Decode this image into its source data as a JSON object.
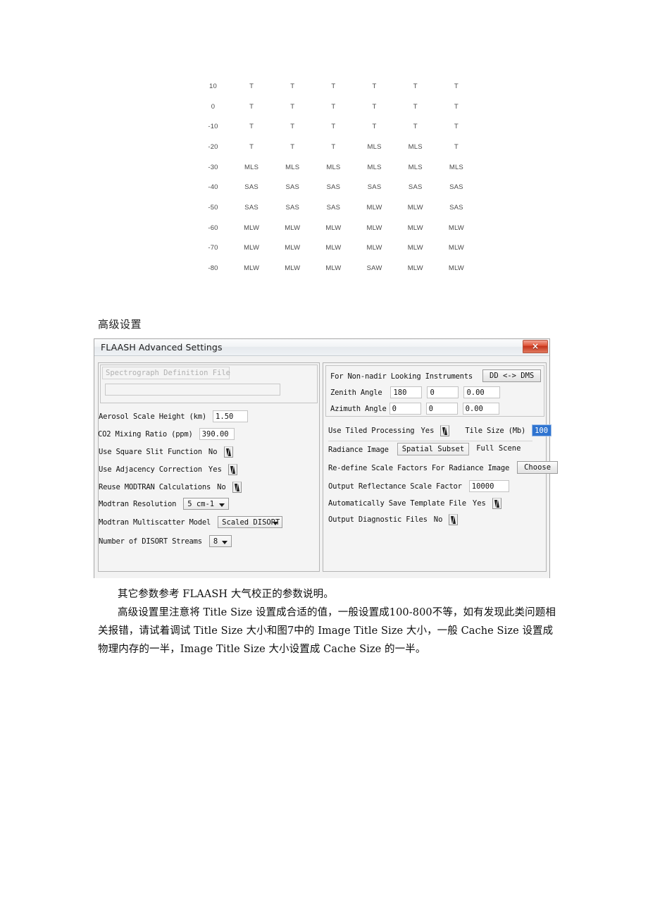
{
  "atmosphere_table": {
    "type": "table",
    "row_labels": [
      "10",
      "0",
      "-10",
      "-20",
      "-30",
      "-40",
      "-50",
      "-60",
      "-70",
      "-80"
    ],
    "rows": [
      [
        "10",
        "T",
        "T",
        "T",
        "T",
        "T",
        "T"
      ],
      [
        "0",
        "T",
        "T",
        "T",
        "T",
        "T",
        "T"
      ],
      [
        "-10",
        "T",
        "T",
        "T",
        "T",
        "T",
        "T"
      ],
      [
        "-20",
        "T",
        "T",
        "T",
        "MLS",
        "MLS",
        "T"
      ],
      [
        "-30",
        "MLS",
        "MLS",
        "MLS",
        "MLS",
        "MLS",
        "MLS"
      ],
      [
        "-40",
        "SAS",
        "SAS",
        "SAS",
        "SAS",
        "SAS",
        "SAS"
      ],
      [
        "-50",
        "SAS",
        "SAS",
        "SAS",
        "MLW",
        "MLW",
        "SAS"
      ],
      [
        "-60",
        "MLW",
        "MLW",
        "MLW",
        "MLW",
        "MLW",
        "MLW"
      ],
      [
        "-70",
        "MLW",
        "MLW",
        "MLW",
        "MLW",
        "MLW",
        "MLW"
      ],
      [
        "-80",
        "MLW",
        "MLW",
        "MLW",
        "SAW",
        "MLW",
        "MLW"
      ]
    ]
  },
  "section": {
    "heading": "高级设置"
  },
  "dialog": {
    "title": "FLAASH Advanced Settings",
    "close_icon": "×",
    "accent_close_color": "#d2452a",
    "left_panel": {
      "spectrograph_group_label": "Spectrograph Definition File",
      "spectrograph_value": "",
      "aerosol_scale_height_label": "Aerosol Scale Height (km)",
      "aerosol_scale_height_value": "1.50",
      "co2_mixing_ratio_label": "CO2 Mixing Ratio (ppm)",
      "co2_mixing_ratio_value": "390.00",
      "use_square_slit_label": "Use Square Slit Function",
      "use_square_slit_value": "No",
      "use_adjacency_label": "Use Adjacency Correction",
      "use_adjacency_value": "Yes",
      "reuse_modtran_label": "Reuse MODTRAN Calculations",
      "reuse_modtran_value": "No",
      "modtran_resolution_label": "Modtran Resolution",
      "modtran_resolution_value": "5 cm-1",
      "modtran_multiscatter_label": "Modtran Multiscatter Model",
      "modtran_multiscatter_value": "Scaled DISORT",
      "disort_streams_label": "Number of DISORT Streams",
      "disort_streams_value": "8"
    },
    "right_panel": {
      "nonnadir_label": "For Non-nadir Looking Instruments",
      "dd_dms_button": "DD <-> DMS",
      "zenith_label": "Zenith Angle",
      "zenith_deg": "180",
      "zenith_min": "0",
      "zenith_sec": "0.00",
      "azimuth_label": "Azimuth Angle",
      "azimuth_deg": "0",
      "azimuth_min": "0",
      "azimuth_sec": "0.00",
      "tiled_processing_label": "Use Tiled Processing",
      "tiled_processing_value": "Yes",
      "tile_size_label": "Tile Size (Mb)",
      "tile_size_value": "100",
      "radiance_image_label": "Radiance Image",
      "radiance_option_selected": "Spatial Subset",
      "radiance_option_other": "Full Scene",
      "redefine_scale_label": "Re-define Scale Factors For Radiance Image",
      "choose_button": "Choose",
      "output_reflectance_label": "Output Reflectance Scale Factor",
      "output_reflectance_value": "10000",
      "auto_save_template_label": "Automatically Save Template File",
      "auto_save_template_value": "Yes",
      "output_diagnostic_label": "Output Diagnostic Files",
      "output_diagnostic_value": "No"
    }
  },
  "body_text": {
    "para1": "其它参数参考 FLAASH 大气校正的参数说明。",
    "para2_a": "高级设置里注意将 Title Size 设置成合适的值，一般设置成100-800不等，如有发现此类问题相关报错，请试着调试 Title Size 大小和图7中的 Image Title Size 大小，一般 Cache Size 设置成物理内存的一半，Image Title Size 大小设置成 Cache Size 的一半。"
  }
}
